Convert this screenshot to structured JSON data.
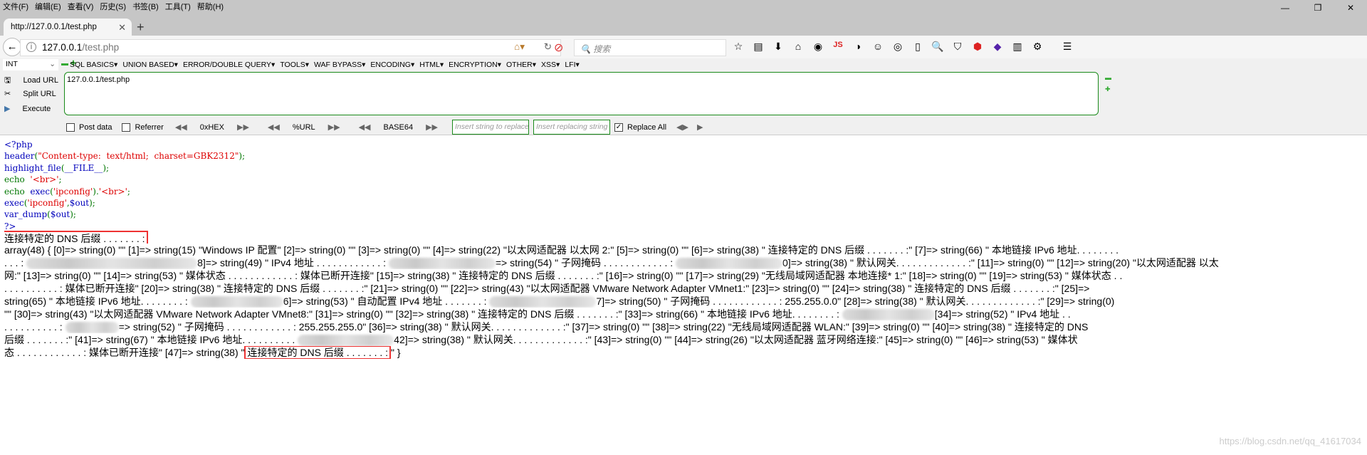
{
  "menu": [
    "文件(F)",
    "编辑(E)",
    "查看(V)",
    "历史(S)",
    "书签(B)",
    "工具(T)",
    "帮助(H)"
  ],
  "window_controls": [
    "—",
    "❐",
    "✕"
  ],
  "tab": {
    "title": "http://127.0.0.1/test.php",
    "close": "✕",
    "new": "+"
  },
  "nav": {
    "host": "127.0.0.1",
    "path": "/test.php",
    "search_placeholder": "搜索"
  },
  "toolbar_icons": [
    "star-icon",
    "reader-icon",
    "download-icon",
    "home-icon",
    "globe-icon",
    "js-icon",
    "translate-icon",
    "cookie-icon",
    "target-icon",
    "clipboard-icon",
    "zoom-icon",
    "shield-icon",
    "adblock-icon",
    "gem-icon",
    "color-icon",
    "gear-icon",
    "menu-icon"
  ],
  "hackbar": {
    "select": "INT",
    "menus": [
      "SQL BASICS▾",
      "UNION BASED▾",
      "ERROR/DOUBLE QUERY▾",
      "TOOLS▾",
      "WAF BYPASS▾",
      "ENCODING▾",
      "HTML▾",
      "ENCRYPTION▾",
      "OTHER▾",
      "XSS▾",
      "LFI▾"
    ],
    "load_url": "Load URL",
    "split_url": "Split URL",
    "execute": "Execute",
    "url_value": "127.0.0.1/test.php",
    "post_data": "Post data",
    "referrer": "Referrer",
    "hex": "0xHEX",
    "url": "%URL",
    "base64": "BASE64",
    "insert_placeholder": "Insert string to replace",
    "replacing_placeholder": "Insert replacing string",
    "replace_all": "Replace All"
  },
  "code": [
    [
      [
        "b",
        "<?php"
      ]
    ],
    [
      [
        "b",
        "header"
      ],
      [
        "g",
        "("
      ],
      [
        "r",
        "\"Content-type:  text/html;  charset=GBK2312\""
      ],
      [
        "g",
        ");"
      ]
    ],
    [
      [
        "b",
        "highlight_file"
      ],
      [
        "g",
        "("
      ],
      [
        "b",
        "__FILE__"
      ],
      [
        "g",
        ");"
      ]
    ],
    [
      [
        "g",
        "echo  "
      ],
      [
        "r",
        "'<br>'"
      ],
      [
        "g",
        ";"
      ]
    ],
    [
      [
        "g",
        "echo  "
      ],
      [
        "b",
        "exec"
      ],
      [
        "g",
        "("
      ],
      [
        "r",
        "'ipconfig'"
      ],
      [
        "g",
        ")."
      ],
      [
        "r",
        "'<br>'"
      ],
      [
        "g",
        ";"
      ]
    ],
    [
      [
        "b",
        "exec"
      ],
      [
        "g",
        "("
      ],
      [
        "r",
        "'ipconfig'"
      ],
      [
        "g",
        ","
      ],
      [
        "b",
        "$out"
      ],
      [
        "g",
        ");"
      ]
    ],
    [
      [
        "b",
        "var_dump"
      ],
      [
        "g",
        "("
      ],
      [
        "b",
        "$out"
      ],
      [
        "g",
        ");"
      ]
    ],
    [
      [
        "b",
        "?>"
      ]
    ]
  ],
  "output": {
    "first_line": "连接特定的 DNS 后缀 . . . . . . . :",
    "lines": [
      [
        {
          "t": "array(48) { [0]=> string(0) \"\" [1]=> string(15) \"Windows IP 配置\" [2]=> string(0) \"\" [3]=> string(0) \"\" [4]=> string(22) \"以太网适配器 以太网 2:\" [5]=> string(0) \"\" [6]=> string(38) \" 连接特定的 DNS 后缀 . . . . . . . :\" [7]=> string(66) \" 本地链接 IPv6 地址. . . . . . . ."
        }
      ],
      [
        {
          "t": ". . . : "
        },
        {
          "blur": 240
        },
        {
          "t": "8]=> string(49) \" IPv4 地址 . . . . . . . . . . . . : "
        },
        {
          "blur": 150
        },
        {
          "t": "=> string(54) \" 子网掩码 . . . . . . . . . . . . : "
        },
        {
          "blur": 150
        },
        {
          "t": "0]=> string(38) \" 默认网关. . . . . . . . . . . . . :\" [11]=> string(0) \"\" [12]=> string(20) \"以太网适配器 以太"
        }
      ],
      [
        {
          "t": "网:\" [13]=> string(0) \"\" [14]=> string(53) \" 媒体状态 . . . . . . . . . . . . : 媒体已断开连接\" [15]=> string(38) \" 连接特定的 DNS 后缀 . . . . . . . :\" [16]=> string(0) \"\" [17]=> string(29) \"无线局域网适配器 本地连接* 1:\" [18]=> string(0) \"\" [19]=> string(53) \" 媒体状态 . ."
        }
      ],
      [
        {
          "t": ". . . . . . . . . . : 媒体已断开连接\" [20]=> string(38) \" 连接特定的 DNS 后缀 . . . . . . . :\" [21]=> string(0) \"\" [22]=> string(43) \"以太网适配器 VMware Network Adapter VMnet1:\" [23]=> string(0) \"\" [24]=> string(38) \" 连接特定的 DNS 后缀 . . . . . . . :\" [25]=>"
        }
      ],
      [
        {
          "t": "string(65) \" 本地链接 IPv6 地址. . . . . . . . : "
        },
        {
          "blur": 130
        },
        {
          "t": "6]=> string(53) \" 自动配置 IPv4 地址 . . . . . . . : "
        },
        {
          "blur": 150
        },
        {
          "t": "7]=> string(50) \" 子网掩码 . . . . . . . . . . . . : 255.255.0.0\" [28]=> string(38) \" 默认网关. . . . . . . . . . . . . :\" [29]=> string(0)"
        }
      ],
      [
        {
          "t": "\"\" [30]=> string(43) \"以太网适配器 VMware Network Adapter VMnet8:\" [31]=> string(0) \"\" [32]=> string(38) \" 连接特定的 DNS 后缀 . . . . . . . :\" [33]=> string(66) \" 本地链接 IPv6 地址. . . . . . . . : "
        },
        {
          "blur": 130
        },
        {
          "t": "[34]=> string(52) \" IPv4 地址 . ."
        }
      ],
      [
        {
          "t": ". . . . . . . . . . : "
        },
        {
          "blur": 75
        },
        {
          "t": "=> string(52) \" 子网掩码 . . . . . . . . . . . . : 255.255.255.0\" [36]=> string(38) \" 默认网关. . . . . . . . . . . . . :\" [37]=> string(0) \"\" [38]=> string(22) \"无线局域网适配器 WLAN:\" [39]=> string(0) \"\" [40]=> string(38) \" 连接特定的 DNS"
        }
      ],
      [
        {
          "t": "后缀 . . . . . . . :\" [41]=> string(67) \" 本地链接 IPv6 地址. . . . . . . . . . "
        },
        {
          "blur": 135
        },
        {
          "t": "42]=> string(38) \" 默认网关. . . . . . . . . . . . . :\" [43]=> string(0) \"\" [44]=> string(26) \"以太网适配器 蓝牙网络连接:\" [45]=> string(0) \"\" [46]=> string(53) \" 媒体状"
        }
      ],
      [
        {
          "t": "态 . . . . . . . . . . . . : 媒体已断开连接\" [47]=> string(38) \""
        },
        {
          "box": "连接特定的 DNS 后缀 . . . . . . . :"
        },
        {
          "t": "\" }"
        }
      ]
    ]
  },
  "watermark": "https://blog.csdn.net/qq_41617034",
  "colors": {
    "php_default": "#0000BB",
    "php_string": "#DD0000",
    "php_keyword": "#007700",
    "highlight_box": "#EE3333",
    "hackbar_border": "#1A8A1A"
  }
}
